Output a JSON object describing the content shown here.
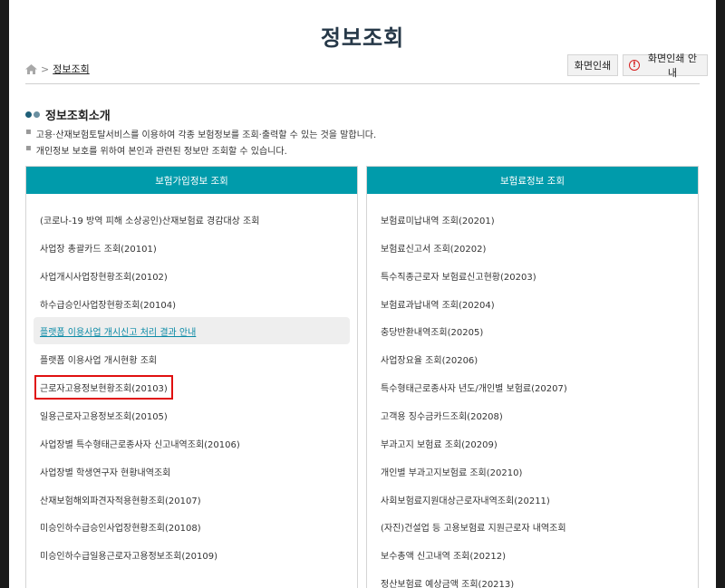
{
  "page": {
    "title": "정보조회"
  },
  "breadcrumb": {
    "home_icon": "home-icon",
    "separator": ">",
    "current": "정보조회"
  },
  "toolbar": {
    "print_label": "화면인쇄",
    "print_guide_label": "화면인쇄 안내",
    "guide_icon": "warning-circle-icon",
    "guide_icon_glyph": "!"
  },
  "intro": {
    "heading": "정보조회소개",
    "bullet": "▪",
    "lines": [
      "고용·산재보험토탈서비스를 이용하여 각종 보험정보를 조회·출력할 수 있는 것을 말합니다.",
      "개인정보 보호를 위하여 본인과 관련된 정보만 조회할 수 있습니다."
    ]
  },
  "left_panel": {
    "title": "보험가입정보 조회",
    "items": [
      "(코로나-19 방역 피해 소상공인)산재보험료 경감대상 조회",
      "사업장 총괄카드 조회(20101)",
      "사업개시사업장현황조회(20102)",
      "하수급승인사업장현황조회(20104)",
      "플랫폼 이용사업 개시신고 처리 결과 안내",
      "플랫폼 이용사업 개시현황 조회",
      "근로자고용정보현황조회(20103)",
      "일용근로자고용정보조회(20105)",
      "사업장별 특수형태근로종사자 신고내역조회(20106)",
      "사업장별 학생연구자 현황내역조회",
      "산재보험해외파견자적용현황조회(20107)",
      "미승인하수급승인사업장현황조회(20108)",
      "미승인하수급일용근로자고용정보조회(20109)"
    ]
  },
  "right_panel": {
    "title": "보험료정보 조회",
    "items": [
      "보험료미납내역 조회(20201)",
      "보험료신고서 조회(20202)",
      "특수직종근로자 보험료신고현황(20203)",
      "보험료과납내역 조회(20204)",
      "충당반환내역조회(20205)",
      "사업장요율 조회(20206)",
      "특수형태근로종사자 년도/개인별 보험료(20207)",
      "고객용 징수금카드조회(20208)",
      "부과고지 보험료 조회(20209)",
      "개인별 부과고지보험료 조회(20210)",
      "사회보험료지원대상근로자내역조회(20211)",
      "(자진)건설업 등 고용보험료 지원근로자 내역조회",
      "보수총액 신고내역 조회(20212)",
      "정산보험료 예상금액 조회(20213)"
    ]
  },
  "colors": {
    "accent": "#009bab",
    "title": "#263848",
    "highlight_box": "#e01010",
    "link": "#0a8aa6"
  }
}
